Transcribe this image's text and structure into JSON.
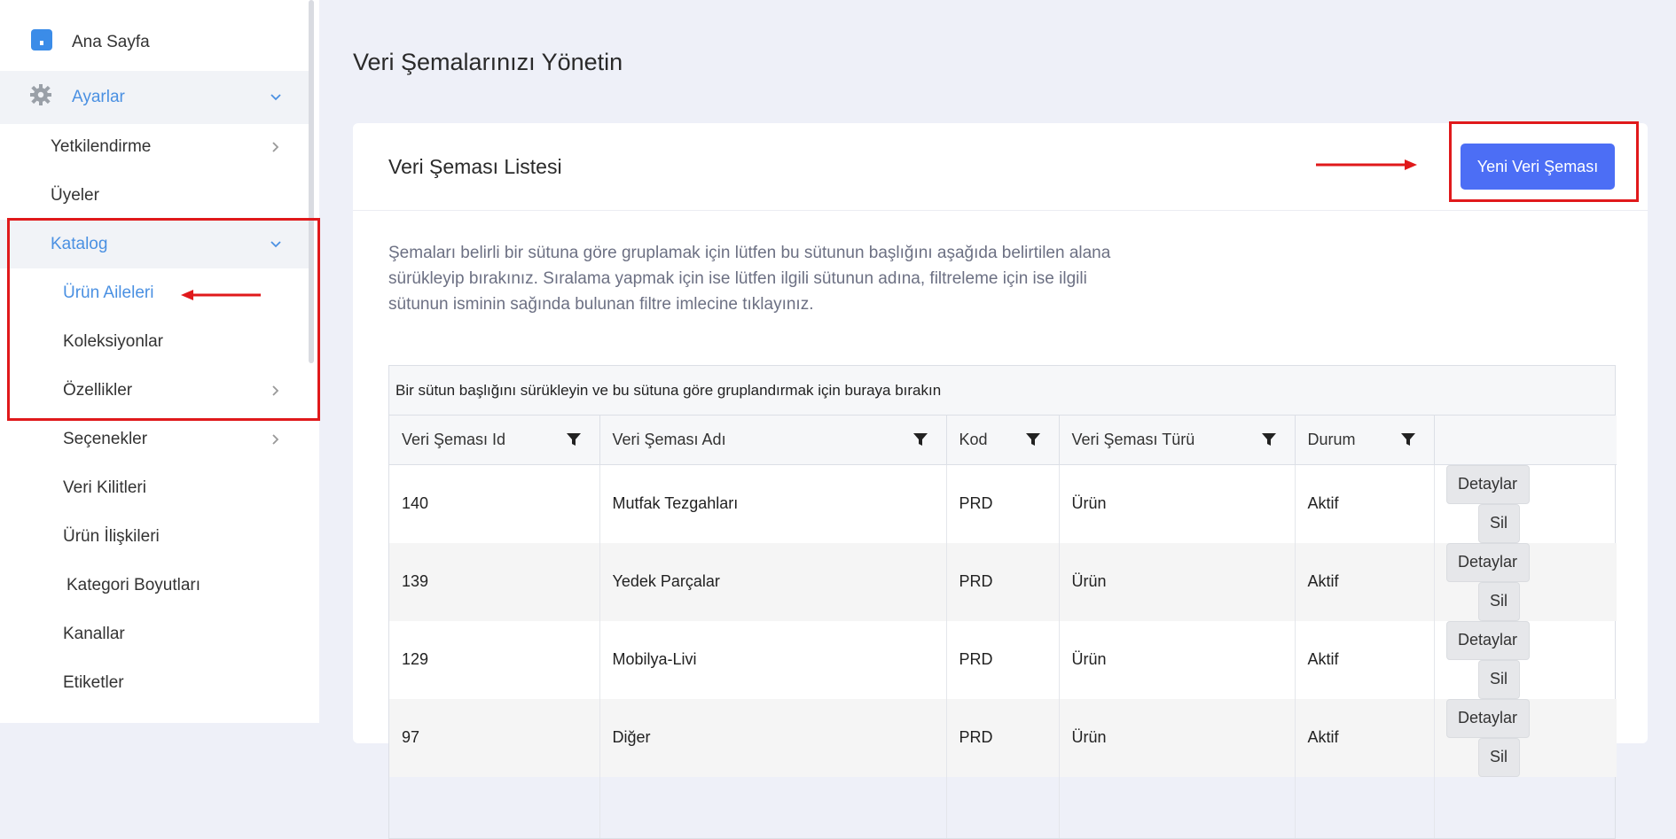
{
  "sidebar": {
    "items": [
      {
        "label": "Ana Sayfa",
        "icon": "home-icon"
      },
      {
        "label": "Ayarlar",
        "icon": "gear-icon"
      },
      {
        "label": "Yetkilendirme"
      },
      {
        "label": "Üyeler"
      },
      {
        "label": "Katalog"
      },
      {
        "label": "Ürün Aileleri"
      },
      {
        "label": "Koleksiyonlar"
      },
      {
        "label": "Özellikler"
      },
      {
        "label": "Seçenekler"
      },
      {
        "label": "Veri Kilitleri"
      },
      {
        "label": "Ürün İlişkileri"
      },
      {
        "label": "Kategori Boyutları"
      },
      {
        "label": "Kanallar"
      },
      {
        "label": "Etiketler"
      }
    ]
  },
  "page": {
    "title": "Veri Şemalarınızı Yönetin"
  },
  "card": {
    "title": "Veri Şeması Listesi",
    "new_button": "Yeni Veri Şeması",
    "info": "Şemaları belirli bir sütuna göre gruplamak için lütfen bu sütunun başlığını aşağıda belirtilen alana sürükleyip bırakınız. Sıralama yapmak için ise lütfen ilgili sütunun adına, filtreleme için ise ilgili sütunun isminin sağında bulunan filtre imlecine tıklayınız."
  },
  "grid": {
    "group_panel": "Bir sütun başlığını sürükleyin ve bu sütuna göre gruplandırmak için buraya bırakın",
    "columns": [
      "Veri Şeması Id",
      "Veri Şeması Adı",
      "Kod",
      "Veri Şeması Türü",
      "Durum"
    ],
    "details_label": "Detaylar",
    "delete_label": "Sil",
    "rows": [
      {
        "id": "140",
        "name": "Mutfak Tezgahları",
        "code": "PRD",
        "type": "Ürün",
        "status": "Aktif"
      },
      {
        "id": "139",
        "name": "Yedek Parçalar",
        "code": "PRD",
        "type": "Ürün",
        "status": "Aktif"
      },
      {
        "id": "129",
        "name": "Mobilya-Livi",
        "code": "PRD",
        "type": "Ürün",
        "status": "Aktif"
      },
      {
        "id": "97",
        "name": "Diğer",
        "code": "PRD",
        "type": "Ürün",
        "status": "Aktif"
      }
    ]
  },
  "colors": {
    "accent": "#4a90e2",
    "primary_button": "#4c6ef5",
    "annotation_red": "#e0191b"
  }
}
